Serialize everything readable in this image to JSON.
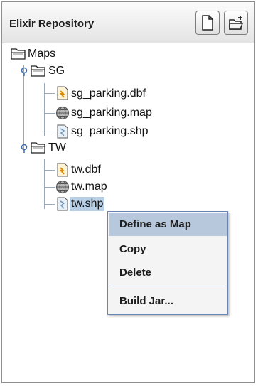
{
  "header": {
    "title": "Elixir Repository",
    "buttons": [
      {
        "icon": "new-file-icon"
      },
      {
        "icon": "new-folder-icon"
      }
    ]
  },
  "tree": {
    "root": {
      "label": "Maps",
      "icon": "folder-icon"
    },
    "groups": [
      {
        "label": "SG",
        "icon": "folder-icon",
        "expanded": true,
        "children": [
          {
            "label": "sg_parking.dbf",
            "icon": "dbf-file-icon"
          },
          {
            "label": "sg_parking.map",
            "icon": "globe-map-icon"
          },
          {
            "label": "sg_parking.shp",
            "icon": "shp-file-icon"
          }
        ]
      },
      {
        "label": "TW",
        "icon": "folder-icon",
        "expanded": true,
        "children": [
          {
            "label": "tw.dbf",
            "icon": "dbf-file-icon"
          },
          {
            "label": "tw.map",
            "icon": "globe-map-icon"
          },
          {
            "label": "tw.shp",
            "icon": "shp-file-icon",
            "selected": true
          }
        ]
      }
    ]
  },
  "context_menu": {
    "items": [
      {
        "label": "Define as Map",
        "active": true
      },
      {
        "label": "Copy"
      },
      {
        "label": "Delete"
      },
      {
        "label": "Build Jar..."
      }
    ]
  },
  "colors": {
    "selection": "#b8cfe6",
    "menu_highlight": "#b7c7dc",
    "menu_border": "#6b85b3",
    "tree_lines": "#9aa8b8"
  }
}
